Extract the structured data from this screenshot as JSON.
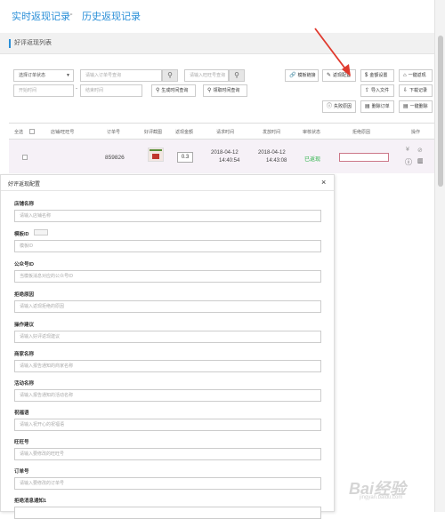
{
  "header": {
    "tab_realtime": "实时返现记录",
    "separator": "-",
    "tab_history": "历史返现记录"
  },
  "section_title": "好评返现列表",
  "filters": {
    "order_status": "选择订单状态",
    "order_no_placeholder": "请输入订单号查询",
    "wangwang_placeholder": "请输入旺旺号查询",
    "start_time": "开始时间",
    "end_time": "结束时间",
    "gen_time_query": "生成时间查询",
    "claim_time_query": "领取时间查询"
  },
  "actions": {
    "template_link": "模板链接",
    "rebate_config": "返现配置",
    "amount_setting": "金额设置",
    "one_click_rebate": "一键返现",
    "import_file": "导入文件",
    "download_record": "下载记录",
    "fail_reason": "失败原因",
    "delete_order": "删除订单",
    "one_click_delete": "一键删除"
  },
  "table": {
    "headers": [
      "全选",
      "店铺/旺旺号",
      "订单号",
      "好评截图",
      "返现金额",
      "请求时间",
      "发放时间",
      "审核状态",
      "拒绝原因",
      "操作"
    ],
    "row": {
      "order_no": "859826",
      "amount": "0.3",
      "request_date": "2018-04-12",
      "request_time": "14:40:54",
      "issue_date": "2018-04-12",
      "issue_time": "14:43:08",
      "status": "已返现"
    }
  },
  "panel": {
    "title": "好评返现配置",
    "close": "×",
    "fields": [
      {
        "label": "店铺名称",
        "placeholder": "请输入店铺名称"
      },
      {
        "label": "模板ID",
        "placeholder": "模板ID"
      },
      {
        "label": "公众号ID",
        "placeholder": "当模板消息对应的公众号ID"
      },
      {
        "label": "拒绝原因",
        "placeholder": "请输入返现拒绝的原因"
      },
      {
        "label": "操作建议",
        "placeholder": "请输入好评返现建议"
      },
      {
        "label": "商家名称",
        "placeholder": "请输入报告通知的商家名称"
      },
      {
        "label": "活动名称",
        "placeholder": "请输入报告通知的活动名称"
      },
      {
        "label": "祝福语",
        "placeholder": "请输入祝开心的祝福语"
      },
      {
        "label": "旺旺号",
        "placeholder": "请输入要修改的旺旺号"
      },
      {
        "label": "订单号",
        "placeholder": "请输入要修改的订单号"
      },
      {
        "label": "拒绝消息通知1",
        "placeholder": ""
      }
    ]
  },
  "watermark": {
    "brand": "Bai经验",
    "url": "jingyan.baidu.com"
  },
  "colors": {
    "accent": "#2a8fd8",
    "success": "#2db34a",
    "arrow": "#e03a2e"
  }
}
